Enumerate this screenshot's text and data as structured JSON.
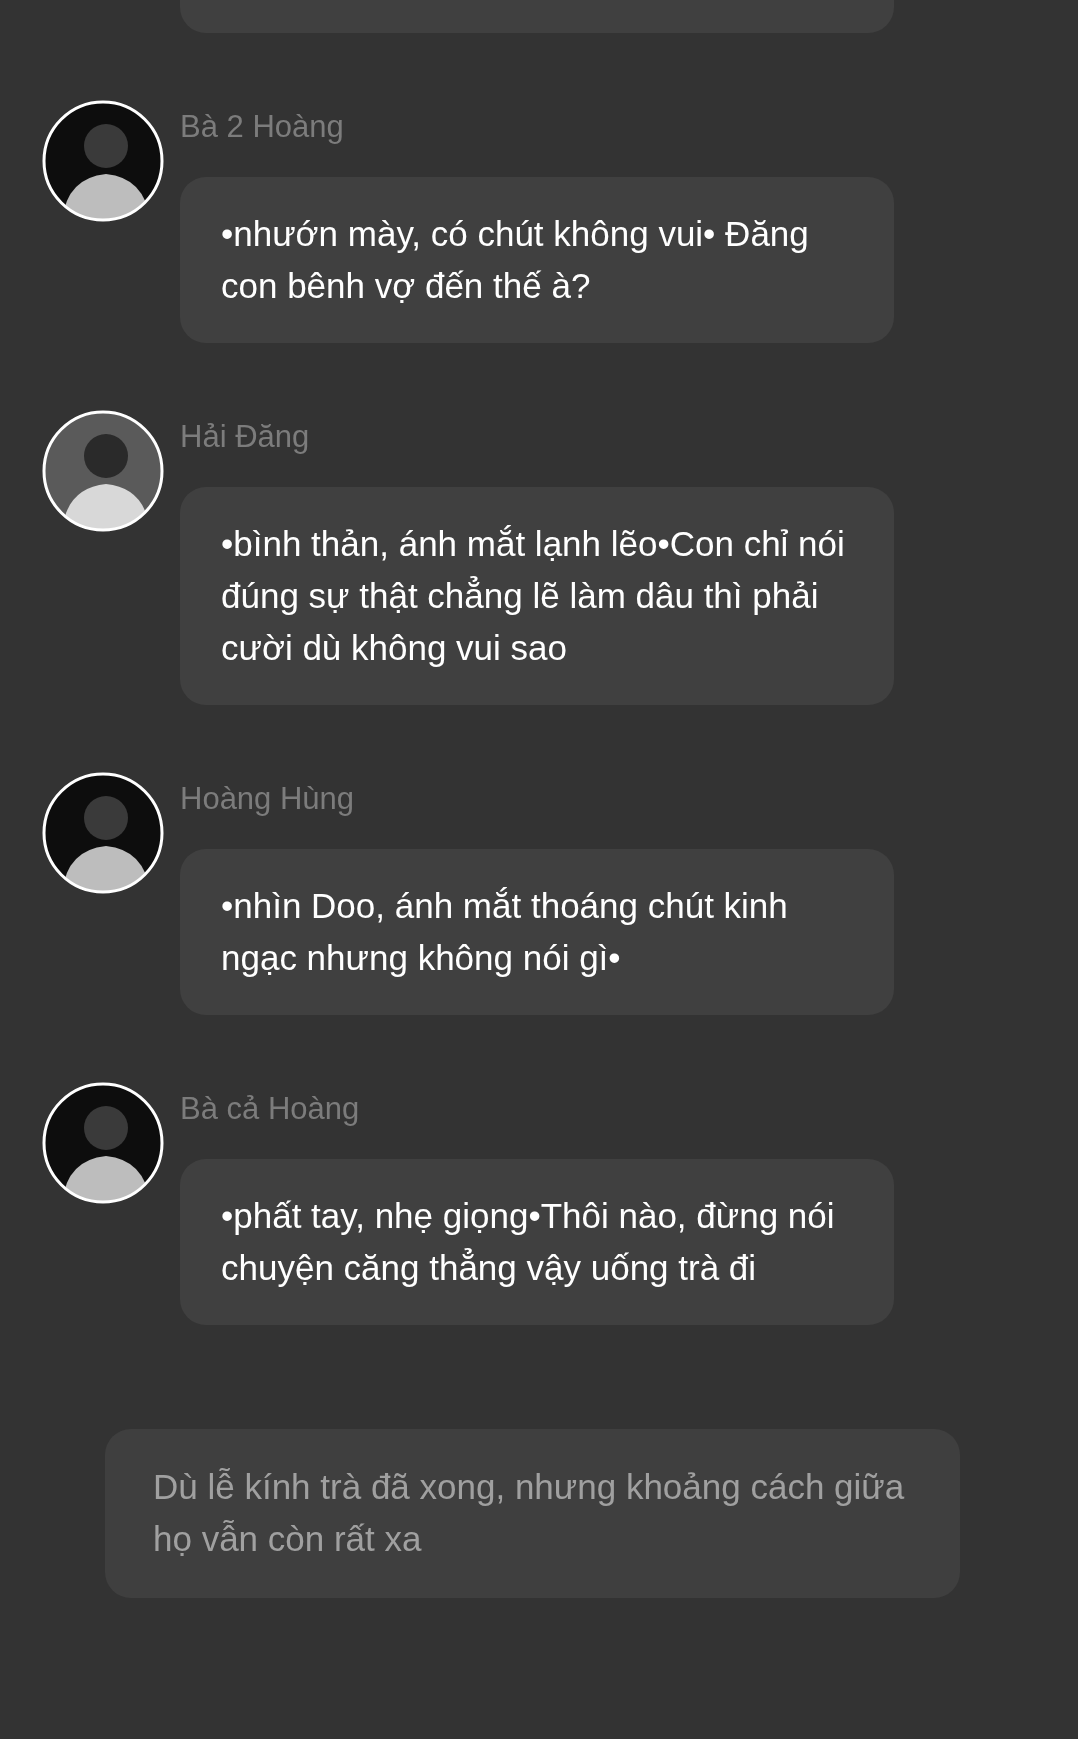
{
  "messages": [
    {
      "sender": "Bà 2 Hoàng",
      "text": "•nhướn mày, có chút không vui• Đăng con bênh vợ đến thế à?"
    },
    {
      "sender": "Hải Đăng",
      "text": "•bình thản, ánh mắt lạnh lẽo•Con chỉ nói đúng sự thật chẳng lẽ làm dâu thì phải cười dù không vui sao"
    },
    {
      "sender": "Hoàng Hùng",
      "text": "•nhìn Doo, ánh mắt thoáng chút kinh ngạc nhưng không nói gì•"
    },
    {
      "sender": "Bà cả Hoàng",
      "text": "•phất tay, nhẹ giọng•Thôi nào, đừng nói chuyện căng thẳng vậy uống trà đi"
    }
  ],
  "narration": "Dù lễ kính trà đã xong, nhưng khoảng cách giữa họ vẫn còn rất xa"
}
